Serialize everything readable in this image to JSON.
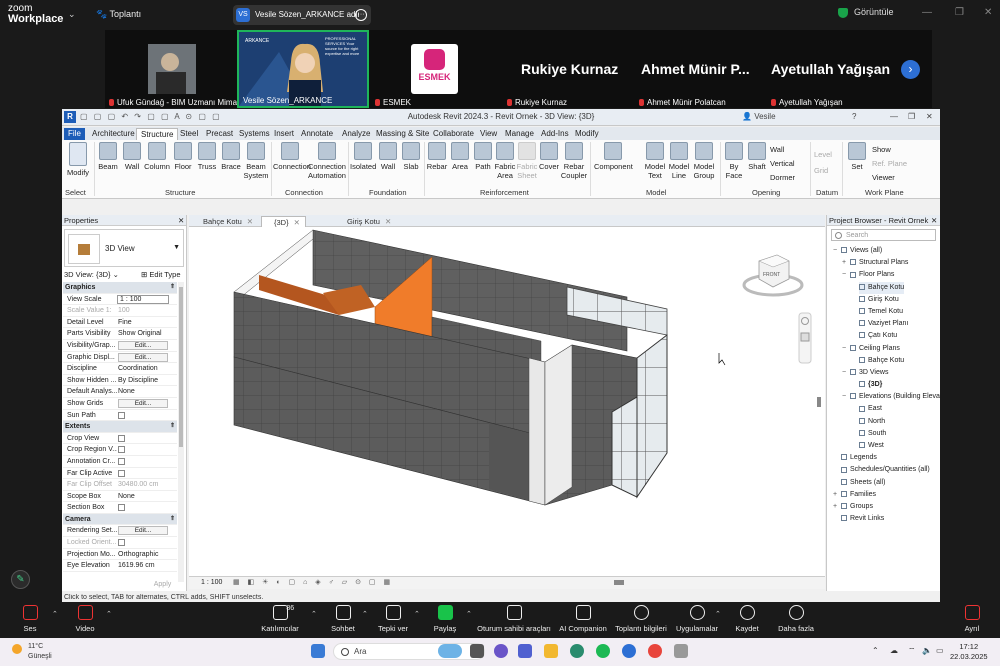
{
  "zoom": {
    "brand_line1": "zoom",
    "brand_line2": "Workplace",
    "meeting_name": "Toplantı",
    "share_initials": "VS",
    "share_label": "Vesile Sözen_ARKANCE adlı kişini",
    "view_label": "Görüntüle",
    "participants": [
      {
        "name": "Ufuk Gündağ - BIM Uzmanı Mimar",
        "muted": true
      },
      {
        "name": "Vesile Sözen_ARKANCE",
        "muted": false
      },
      {
        "name": "ESMEK",
        "muted": true
      },
      {
        "name": "Rukiye Kurnaz",
        "muted": true
      },
      {
        "name": "Ahmet Münir Polatcan",
        "muted": true
      },
      {
        "name": "Ayetullah Yağışan",
        "muted": true
      }
    ],
    "big_names": [
      "Rukiye Kurnaz",
      "Ahmet Münir P...",
      "Ayetullah Yağışan"
    ],
    "logo_text": "ESMEK",
    "slide_text": "PROFESSIONAL SERVICES Your source for the right expertise and more",
    "arkance": "ARKANCE",
    "toolbar": [
      {
        "label": "Ses",
        "icon": "microphone-muted-icon"
      },
      {
        "label": "Video",
        "icon": "video-off-icon"
      },
      {
        "label": "Katılımcılar",
        "count": "86",
        "icon": "participants-icon"
      },
      {
        "label": "Sohbet",
        "icon": "chat-icon"
      },
      {
        "label": "Tepki ver",
        "icon": "reaction-icon"
      },
      {
        "label": "Paylaş",
        "icon": "share-screen-icon"
      },
      {
        "label": "Oturum sahibi araçları",
        "icon": "host-tools-icon"
      },
      {
        "label": "AI Companion",
        "icon": "ai-companion-icon"
      },
      {
        "label": "Toplantı bilgileri",
        "icon": "info-icon"
      },
      {
        "label": "Uygulamalar",
        "icon": "apps-icon"
      },
      {
        "label": "Kaydet",
        "icon": "record-icon"
      },
      {
        "label": "Daha fazla",
        "icon": "more-icon"
      },
      {
        "label": "Ayrıl",
        "icon": "leave-icon"
      }
    ]
  },
  "revit": {
    "title": "Autodesk Revit 2024.3 - Revit Ornek - 3D View: {3D}",
    "user": "Vesile",
    "tabs": [
      "File",
      "Architecture",
      "Structure",
      "Steel",
      "Precast",
      "Systems",
      "Insert",
      "Annotate",
      "Analyze",
      "Massing & Site",
      "Collaborate",
      "View",
      "Manage",
      "Add-Ins",
      "Modify"
    ],
    "active_tab": "Structure",
    "ribbon": {
      "modify": "Modify",
      "buttons": [
        "Beam",
        "Wall",
        "Column",
        "Floor",
        "Truss",
        "Brace",
        "Beam System",
        "Connection",
        "Connection Automation",
        "Isolated",
        "Wall",
        "Slab",
        "Rebar",
        "Area",
        "Path",
        "Fabric Area",
        "Fabric Sheet",
        "Cover",
        "Rebar Coupler",
        "Component",
        "Model Text",
        "Model Line",
        "Model Group",
        "By Face",
        "Shaft",
        "Level",
        "Grid",
        "Set"
      ],
      "small": [
        "Wall",
        "Vertical",
        "Dormer",
        "Show",
        "Ref. Plane",
        "Viewer"
      ],
      "groups": [
        "Select",
        "Structure",
        "Connection",
        "Foundation",
        "Reinforcement",
        "Model",
        "Opening",
        "Datum",
        "Work Plane"
      ]
    },
    "properties": {
      "title": "Properties",
      "type_name": "3D View",
      "view_dropdown": "3D View: {3D}",
      "edit_type": "Edit Type",
      "rows": [
        {
          "k": "Graphics",
          "section": true
        },
        {
          "k": "View Scale",
          "v": "1 : 100",
          "input": true
        },
        {
          "k": "Scale Value  1:",
          "v": "100",
          "gray": true
        },
        {
          "k": "Detail Level",
          "v": "Fine"
        },
        {
          "k": "Parts Visibility",
          "v": "Show Original"
        },
        {
          "k": "Visibility/Grap...",
          "btn": "Edit..."
        },
        {
          "k": "Graphic Displ...",
          "btn": "Edit..."
        },
        {
          "k": "Discipline",
          "v": "Coordination"
        },
        {
          "k": "Show Hidden ...",
          "v": "By Discipline"
        },
        {
          "k": "Default Analys...",
          "v": "None"
        },
        {
          "k": "Show Grids",
          "btn": "Edit..."
        },
        {
          "k": "Sun Path",
          "cb": true
        },
        {
          "k": "Extents",
          "section": true
        },
        {
          "k": "Crop View",
          "cb": true
        },
        {
          "k": "Crop Region V...",
          "cb": true
        },
        {
          "k": "Annotation Cr...",
          "cb": true
        },
        {
          "k": "Far Clip Active",
          "cb": true
        },
        {
          "k": "Far Clip Offset",
          "v": "30480.00 cm",
          "gray": true
        },
        {
          "k": "Scope Box",
          "v": "None"
        },
        {
          "k": "Section Box",
          "cb": true
        },
        {
          "k": "Camera",
          "section": true
        },
        {
          "k": "Rendering Set...",
          "btn": "Edit..."
        },
        {
          "k": "Locked Orient...",
          "cb": true,
          "gray": true
        },
        {
          "k": "Projection Mo...",
          "v": "Orthographic"
        },
        {
          "k": "Eye Elevation",
          "v": "1619.96 cm"
        }
      ],
      "apply": "Apply"
    },
    "view_tabs": [
      {
        "label": "Bahçe Kotu",
        "active": false
      },
      {
        "label": "{3D}",
        "active": true
      },
      {
        "label": "Giriş Kotu",
        "active": false
      }
    ],
    "scale": "1 : 100",
    "viewcube": "FRONT",
    "browser": {
      "title": "Project Browser - Revit Ornek",
      "search": "Search",
      "tree": [
        {
          "t": "Views (all)",
          "lvl": 0,
          "tg": "−"
        },
        {
          "t": "Structural Plans",
          "lvl": 1,
          "tg": "+"
        },
        {
          "t": "Floor Plans",
          "lvl": 1,
          "tg": "−"
        },
        {
          "t": "Bahçe Kotu",
          "lvl": 2,
          "sel": true
        },
        {
          "t": "Giriş Kotu",
          "lvl": 2
        },
        {
          "t": "Temel Kotu",
          "lvl": 2
        },
        {
          "t": "Vaziyet Planı",
          "lvl": 2
        },
        {
          "t": "Çatı Kotu",
          "lvl": 2
        },
        {
          "t": "Ceiling Plans",
          "lvl": 1,
          "tg": "−"
        },
        {
          "t": "Bahçe Kotu",
          "lvl": 2
        },
        {
          "t": "3D Views",
          "lvl": 1,
          "tg": "−"
        },
        {
          "t": "{3D}",
          "lvl": 2,
          "bold": true
        },
        {
          "t": "Elevations (Building Elevation)",
          "lvl": 1,
          "tg": "−"
        },
        {
          "t": "East",
          "lvl": 2
        },
        {
          "t": "North",
          "lvl": 2
        },
        {
          "t": "South",
          "lvl": 2
        },
        {
          "t": "West",
          "lvl": 2
        },
        {
          "t": "Legends",
          "lvl": 0
        },
        {
          "t": "Schedules/Quantities (all)",
          "lvl": 0
        },
        {
          "t": "Sheets (all)",
          "lvl": 0
        },
        {
          "t": "Families",
          "lvl": 0,
          "tg": "+"
        },
        {
          "t": "Groups",
          "lvl": 0,
          "tg": "+"
        },
        {
          "t": "Revit Links",
          "lvl": 0
        }
      ]
    },
    "status": "Click to select, TAB for alternates, CTRL adds, SHIFT unselects."
  },
  "taskbar": {
    "temp": "11°C",
    "weather": "Güneşli",
    "search": "Ara",
    "time": "17:12",
    "date": "22.03.2025"
  },
  "colors": {
    "accent_blue": "#1d5db8",
    "orange": "#f07c2a",
    "zoom_green": "#19a34a"
  }
}
